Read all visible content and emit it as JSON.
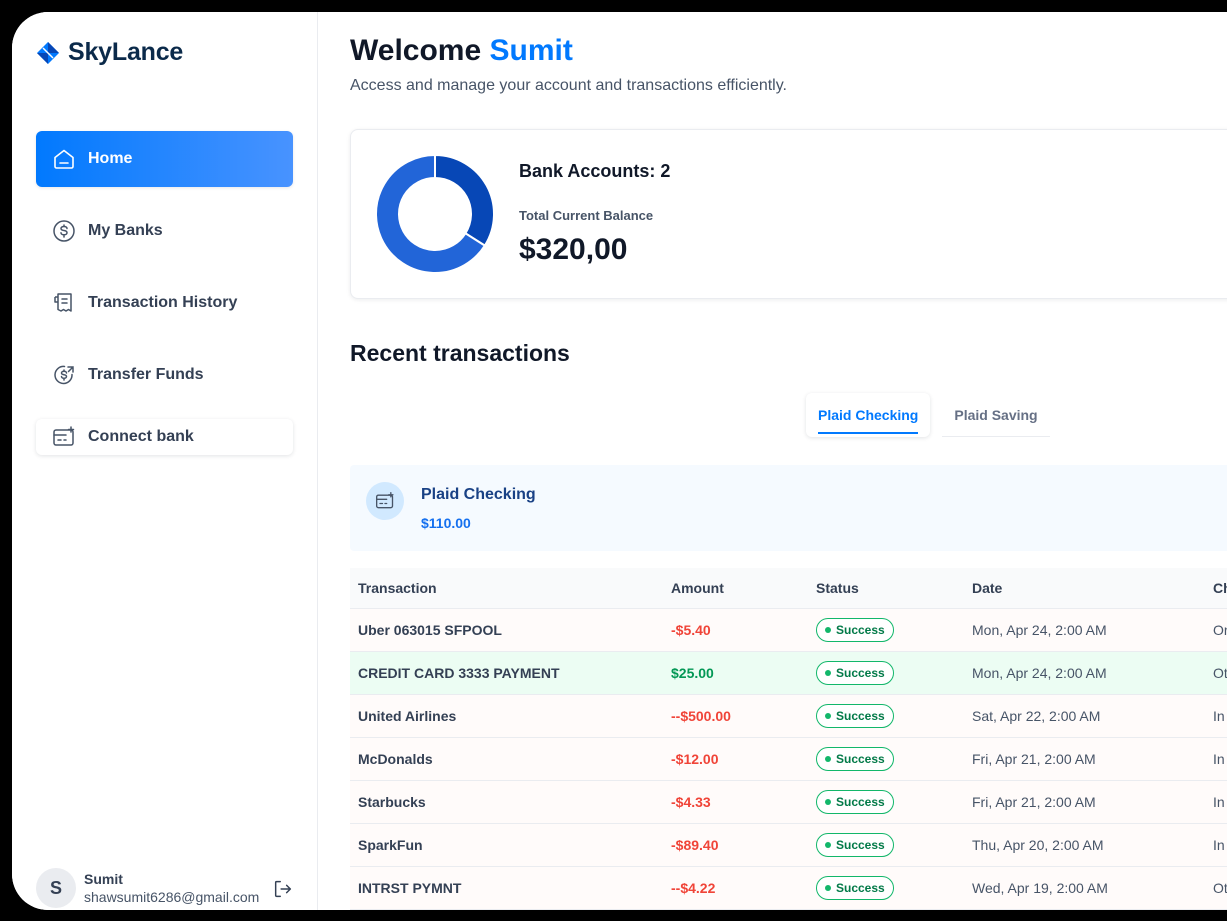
{
  "brand": {
    "name": "SkyLance",
    "icon": "logo-diamond-icon"
  },
  "sidebar": {
    "items": [
      {
        "label": "Home",
        "icon": "home-icon",
        "active": true
      },
      {
        "label": "My Banks",
        "icon": "dollar-circle-icon",
        "active": false
      },
      {
        "label": "Transaction History",
        "icon": "receipt-icon",
        "active": false
      },
      {
        "label": "Transfer Funds",
        "icon": "money-send-icon",
        "active": false
      }
    ],
    "connect_bank": {
      "label": "Connect bank",
      "icon": "add-card-icon"
    }
  },
  "user": {
    "initial": "S",
    "name": "Sumit",
    "email": "shawsumit6286@gmail.com",
    "logout_icon": "logout-icon"
  },
  "header": {
    "greeting": "Welcome",
    "user_name": "Sumit",
    "subtitle": "Access and manage your account and transactions efficiently."
  },
  "balance": {
    "bank_accounts_label": "Bank Accounts: 2",
    "total_label": "Total Current Balance",
    "total_value": "$320,00",
    "donut_shares": [
      0.34,
      0.66
    ],
    "donut_colors": [
      "#0747b6",
      "#2265d8"
    ]
  },
  "recent": {
    "title": "Recent transactions",
    "tabs": [
      {
        "label": "Plaid Checking",
        "active": true
      },
      {
        "label": "Plaid Saving",
        "active": false
      }
    ],
    "account": {
      "name": "Plaid Checking",
      "balance": "$110.00",
      "icon": "add-card-icon"
    }
  },
  "table": {
    "headers": [
      "Transaction",
      "Amount",
      "Status",
      "Date",
      "Ch"
    ],
    "rows": [
      {
        "name": "Uber 063015 SFPOOL",
        "amount": "-$5.40",
        "status": "Success",
        "date": "Mon, Apr 24, 2:00 AM",
        "channel": "Or",
        "type": "debit"
      },
      {
        "name": "CREDIT CARD 3333 PAYMENT",
        "amount": "$25.00",
        "status": "Success",
        "date": "Mon, Apr 24, 2:00 AM",
        "channel": "Ot",
        "type": "credit"
      },
      {
        "name": "United Airlines",
        "amount": "--$500.00",
        "status": "Success",
        "date": "Sat, Apr 22, 2:00 AM",
        "channel": "In",
        "type": "debit"
      },
      {
        "name": "McDonalds",
        "amount": "-$12.00",
        "status": "Success",
        "date": "Fri, Apr 21, 2:00 AM",
        "channel": "In",
        "type": "debit"
      },
      {
        "name": "Starbucks",
        "amount": "-$4.33",
        "status": "Success",
        "date": "Fri, Apr 21, 2:00 AM",
        "channel": "In",
        "type": "debit"
      },
      {
        "name": "SparkFun",
        "amount": "-$89.40",
        "status": "Success",
        "date": "Thu, Apr 20, 2:00 AM",
        "channel": "In",
        "type": "debit"
      },
      {
        "name": "INTRST PYMNT",
        "amount": "--$4.22",
        "status": "Success",
        "date": "Wed, Apr 19, 2:00 AM",
        "channel": "Ot",
        "type": "debit"
      }
    ]
  },
  "colors": {
    "accent": "#0179fe",
    "success": "#12b76a",
    "debit": "#f04438",
    "credit": "#039855"
  }
}
